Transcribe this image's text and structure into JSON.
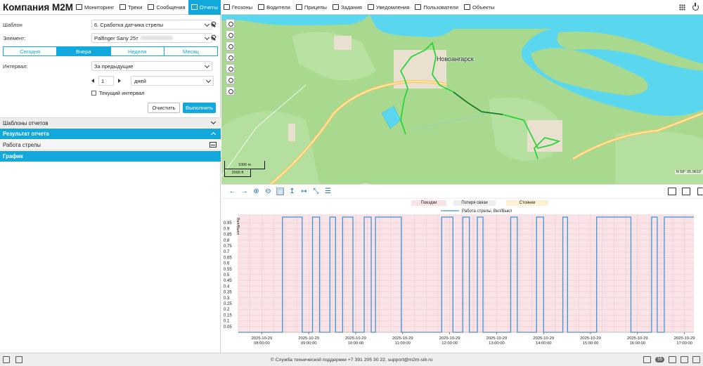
{
  "app": {
    "brand": "Компания M2M"
  },
  "nav": [
    {
      "label": "Мониторинг",
      "icon": "monitor-icon"
    },
    {
      "label": "Треки",
      "icon": "tracks-icon"
    },
    {
      "label": "Сообщения",
      "icon": "messages-icon"
    },
    {
      "label": "Отчеты",
      "icon": "reports-icon",
      "active": true
    },
    {
      "label": "Геозоны",
      "icon": "geofence-icon"
    },
    {
      "label": "Водители",
      "icon": "driver-icon"
    },
    {
      "label": "Прицепы",
      "icon": "trailer-icon"
    },
    {
      "label": "Задания",
      "icon": "tasks-icon"
    },
    {
      "label": "Уведомления",
      "icon": "notifications-icon"
    },
    {
      "label": "Пользователи",
      "icon": "users-icon"
    },
    {
      "label": "Объекты",
      "icon": "objects-icon"
    }
  ],
  "form": {
    "template_label": "Шаблон",
    "template_value": "6. Сработка датчика стрелы",
    "element_label": "Элемент:",
    "element_value": "Palfinger Sany 25т",
    "interval_label": "Интервал:",
    "interval_value": "За предыдущие",
    "count_value": "1",
    "unit_value": "дней",
    "current_interval_label": "Текущий интервал",
    "clear_label": "Очистить",
    "run_label": "Выполнить"
  },
  "period_tabs": [
    {
      "label": "Сегодня"
    },
    {
      "label": "Вчера",
      "active": true
    },
    {
      "label": "Неделя"
    },
    {
      "label": "Месяц"
    }
  ],
  "sections": {
    "templates": "Шаблоны отчетов",
    "result": "Результат отчета",
    "boom": "Работа стрелы",
    "graph": "График"
  },
  "map": {
    "city": "Новоангарск",
    "scale_m": "1000 m",
    "scale_ft": "2000 ft",
    "coord": "N 58° 05.9610'"
  },
  "chart_data": {
    "type": "line",
    "legend": [
      {
        "label": "Поездки",
        "color": "#f9e3e6"
      },
      {
        "label": "Потеря связи",
        "color": "#eeeeee"
      },
      {
        "label": "Стоянки",
        "color": "#fbf0d2"
      }
    ],
    "series": [
      {
        "name": "Работа стрелы, Вкл/Выкл",
        "color": "#3a95d8",
        "steps": [
          [
            7.5,
            0
          ],
          [
            8.44,
            1
          ],
          [
            8.86,
            0
          ],
          [
            9.08,
            1
          ],
          [
            9.23,
            0
          ],
          [
            9.45,
            1
          ],
          [
            9.57,
            0
          ],
          [
            9.72,
            1
          ],
          [
            9.94,
            0
          ],
          [
            10.18,
            1
          ],
          [
            10.33,
            0
          ],
          [
            10.42,
            1
          ],
          [
            10.97,
            0
          ],
          [
            11.83,
            1
          ],
          [
            12.07,
            0
          ],
          [
            12.28,
            1
          ],
          [
            12.42,
            0
          ],
          [
            12.59,
            1
          ],
          [
            12.71,
            0
          ],
          [
            13.3,
            1
          ],
          [
            13.44,
            0
          ],
          [
            13.85,
            1
          ],
          [
            14.0,
            0
          ],
          [
            14.41,
            1
          ],
          [
            14.51,
            0
          ],
          [
            15.13,
            1
          ],
          [
            15.86,
            0
          ],
          [
            16.3,
            1
          ],
          [
            16.42,
            0
          ],
          [
            16.57,
            1
          ],
          [
            17.2,
            1
          ]
        ]
      }
    ],
    "ylabel": "Вкл/Выкл",
    "yticks": [
      "0.05",
      "0.1",
      "0.15",
      "0.2",
      "0.25",
      "0.3",
      "0.35",
      "0.4",
      "0.45",
      "0.5",
      "0.55",
      "0.6",
      "0.65",
      "0.7",
      "0.75",
      "0.8",
      "0.85",
      "0.9",
      "0.95"
    ],
    "xticks": [
      {
        "date": "2025-10-29",
        "time": "08:00:00",
        "h": 8
      },
      {
        "date": "2025-10-29",
        "time": "09:00:00",
        "h": 9
      },
      {
        "date": "2025-10-29",
        "time": "10:00:00",
        "h": 10
      },
      {
        "date": "2025-10-29",
        "time": "11:00:00",
        "h": 11
      },
      {
        "date": "2025-10-29",
        "time": "12:00:00",
        "h": 12
      },
      {
        "date": "2025-10-29",
        "time": "13:00:00",
        "h": 13
      },
      {
        "date": "2025-10-29",
        "time": "14:00:00",
        "h": 14
      },
      {
        "date": "2025-10-29",
        "time": "15:00:00",
        "h": 15
      },
      {
        "date": "2025-10-29",
        "time": "16:00:00",
        "h": 16
      },
      {
        "date": "2025-10-29",
        "time": "17:00:00",
        "h": 17
      }
    ],
    "xlim": [
      7.5,
      17.2
    ],
    "ylim": [
      0,
      1
    ]
  },
  "footer": {
    "support": "© Служба технической поддержки +7 391 205 30 22, support@m2m-sib.ru",
    "badge": "55"
  }
}
